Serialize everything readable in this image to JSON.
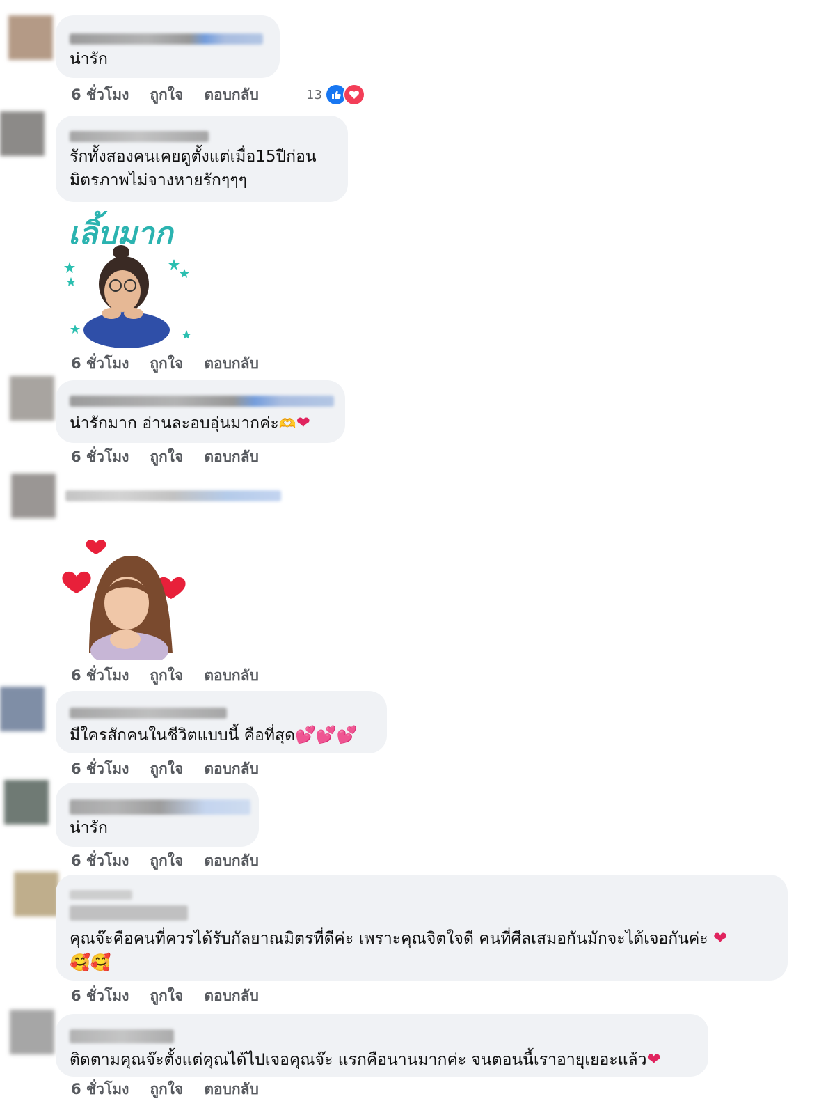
{
  "meta_labels": {
    "time": "6 ชั่วโมง",
    "like": "ถูกใจ",
    "reply": "ตอบกลับ"
  },
  "reaction_count": "13",
  "sticker_caption": "เลิ้บมาก",
  "comments": [
    {
      "text": "น่ารัก"
    },
    {
      "text_line1": "รักทั้งสองคนเคยดูตั้งแต่เมื่อ15ปีก่อน",
      "text_line2": "มิตรภาพไม่จางหายรักๆๆๆ"
    },
    {
      "text": "น่ารักมาก อ่านละอบอุ่นมากค่ะ"
    },
    {
      "text": ""
    },
    {
      "text": "มีใครสักคนในชีวิตแบบนี้ คือที่สุด"
    },
    {
      "text": "น่ารัก"
    },
    {
      "text": "คุณจ๊ะคือคนที่ควรได้รับกัลยาณมิตรที่ดีค่ะ เพราะคุณจิตใจดี คนที่ศีลเสมอกันมักจะได้เจอกันค่ะ"
    },
    {
      "text": "ติดตามคุณจ๊ะตั้งแต่คุณได้ไปเจอคุณจ๊ะ แรกคือนานมากค่ะ จนตอนนี้เราอายุเยอะแล้ว"
    }
  ],
  "colors": {
    "bubble": "#f0f2f5",
    "meta": "#575a5f",
    "like_blue": "#1877f2",
    "love_red": "#f33e58"
  }
}
